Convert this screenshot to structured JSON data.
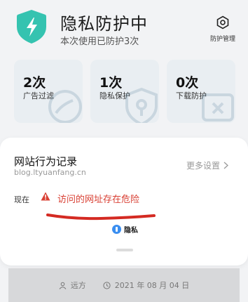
{
  "header": {
    "title": "隐私防护中",
    "subtitle": "本次使用已防护3次",
    "manage_label": "防护管理",
    "shield_color": "#35c3b0"
  },
  "stats": [
    {
      "value": "2次",
      "label": "广告过滤"
    },
    {
      "value": "1次",
      "label": "隐私保护"
    },
    {
      "value": "0次",
      "label": "下载防护"
    }
  ],
  "record": {
    "title": "网站行为记录",
    "url": "blog.ltyuanfang.cn",
    "more_label": "更多设置",
    "time_label": "现在",
    "warning": "访问的网址存在危险",
    "privacy_label": "隐私",
    "warning_color": "#d94034"
  },
  "footer": {
    "author": "远方",
    "date": "2021 年 08 月 04 日"
  }
}
